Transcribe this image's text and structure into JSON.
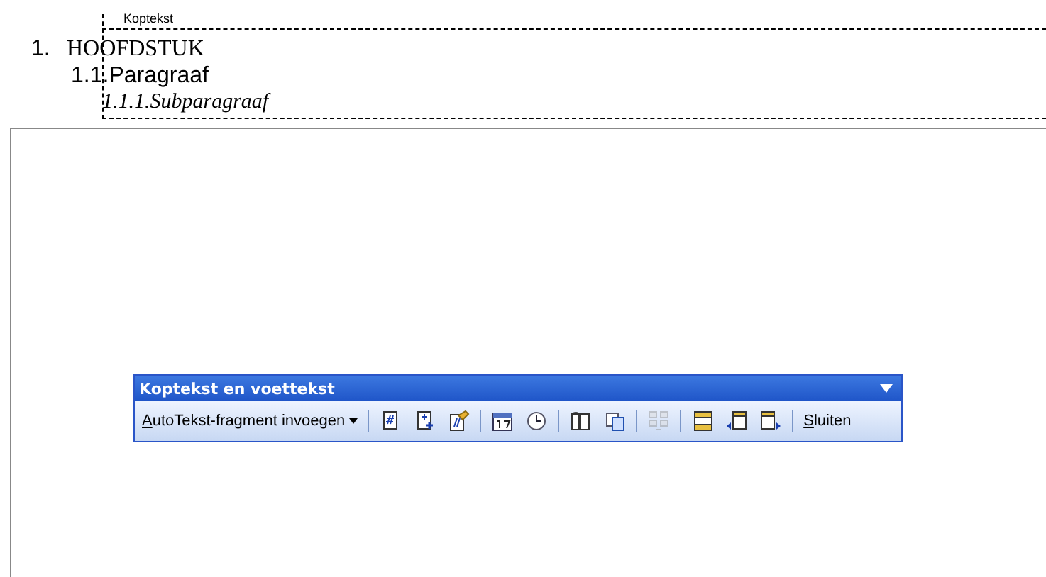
{
  "header_area": {
    "label": "Koptekst",
    "lines": [
      {
        "kind": "chapter",
        "number": "1.",
        "text": "HOOFDSTUK"
      },
      {
        "kind": "paragraph",
        "number": "1.1",
        "text": ".Paragraaf"
      },
      {
        "kind": "subparagraph",
        "text": "1.1.1.Subparagraaf"
      }
    ]
  },
  "toolbar": {
    "title": "Koptekst en voettekst",
    "groups": [
      [
        {
          "kind": "menu",
          "label": "AutoTekst-fragment invoegen",
          "disabled": false
        }
      ],
      [
        {
          "kind": "icon",
          "disabled": false
        },
        {
          "kind": "icon",
          "disabled": false
        },
        {
          "kind": "icon",
          "disabled": false
        }
      ],
      [
        {
          "kind": "icon",
          "disabled": false
        },
        {
          "kind": "icon",
          "disabled": false
        }
      ],
      [
        {
          "kind": "icon",
          "disabled": false
        },
        {
          "kind": "icon",
          "disabled": false
        }
      ],
      [
        {
          "kind": "icon",
          "disabled": true
        }
      ],
      [
        {
          "kind": "icon",
          "disabled": false
        },
        {
          "kind": "icon",
          "disabled": false
        },
        {
          "kind": "icon",
          "disabled": false
        }
      ],
      [
        {
          "kind": "text",
          "label": "Sluiten",
          "disabled": false
        }
      ]
    ]
  }
}
